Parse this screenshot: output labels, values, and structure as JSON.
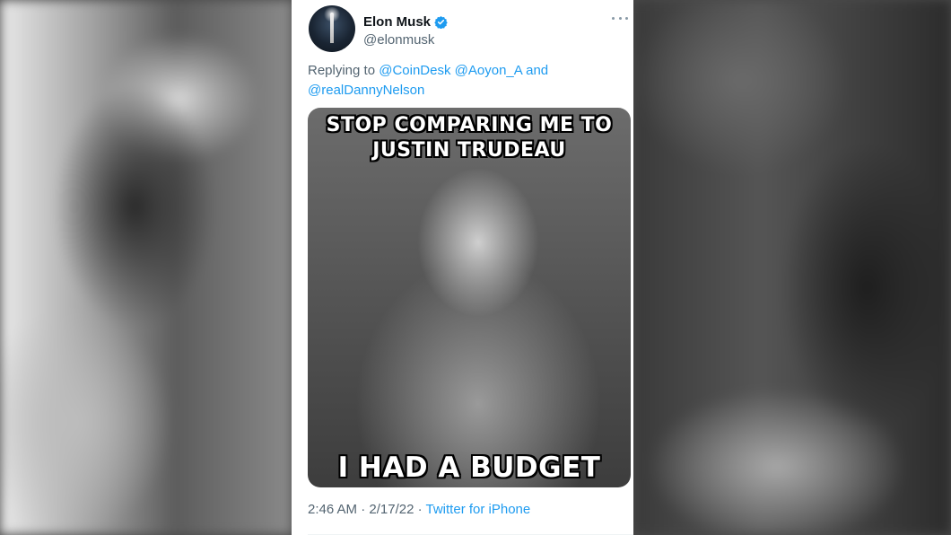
{
  "tweet": {
    "author": {
      "display_name": "Elon Musk",
      "handle": "@elonmusk",
      "verified_icon": "verified-badge-icon",
      "avatar_icon": "avatar"
    },
    "reply": {
      "prefix": "Replying to",
      "mentions": [
        "@CoinDesk",
        "@Aoyon_A",
        "@realDannyNelson"
      ],
      "joiner": "and"
    },
    "media": {
      "caption_top": "STOP COMPARING ME TO JUSTIN TRUDEAU",
      "caption_bottom": "I HAD A BUDGET"
    },
    "meta": {
      "time": "2:46 AM",
      "date": "2/17/22",
      "separator": "·",
      "source": "Twitter for iPhone"
    },
    "more_icon": "more-options-icon"
  },
  "colors": {
    "accent": "#1d9bf0",
    "text_primary": "#0f1419",
    "text_secondary": "#536471"
  }
}
